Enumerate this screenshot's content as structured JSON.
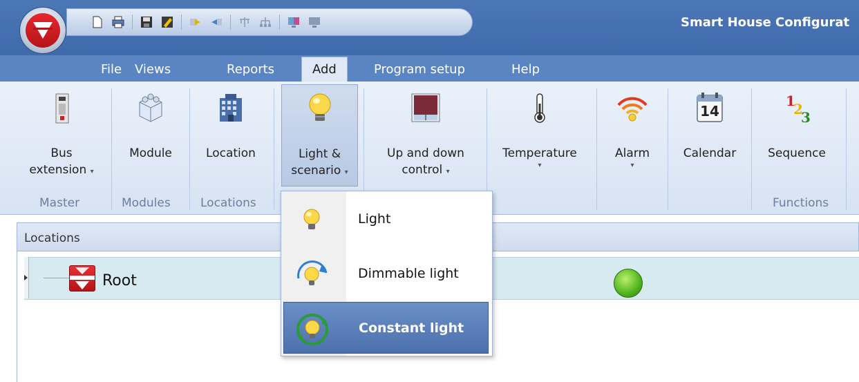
{
  "window": {
    "title": "Smart House Configurat"
  },
  "quick_access_toolbar": {
    "icons": [
      "new-document-icon",
      "print-icon",
      "save-icon",
      "edit-icon",
      "export-icon",
      "import-icon",
      "network-icon",
      "topology-icon",
      "monitor-color-icon",
      "monitor-icon"
    ]
  },
  "menubar": {
    "items": [
      {
        "label": "File"
      },
      {
        "label": "Views"
      },
      {
        "label": "Reports"
      },
      {
        "label": "Add",
        "active": true
      },
      {
        "label": "Program setup"
      },
      {
        "label": "Help"
      }
    ]
  },
  "ribbon": {
    "buttons": {
      "bus_extension": {
        "line1": "Bus",
        "line2": "extension"
      },
      "module": {
        "line1": "Module"
      },
      "location": {
        "line1": "Location"
      },
      "light_scenario": {
        "line1": "Light &",
        "line2": "scenario"
      },
      "up_down": {
        "line1": "Up and down",
        "line2": "control"
      },
      "temperature": {
        "line1": "Temperature"
      },
      "alarm": {
        "line1": "Alarm"
      },
      "calendar": {
        "line1": "Calendar",
        "day": "14"
      },
      "sequence": {
        "line1": "Sequence",
        "digits": [
          "1",
          "2",
          "3"
        ]
      }
    },
    "groups": {
      "master": "Master",
      "modules": "Modules",
      "locations": "Locations",
      "functions": "Functions"
    }
  },
  "panel": {
    "title": "Locations"
  },
  "tree": {
    "root_label": "Root",
    "status_color": "#4fb41d"
  },
  "dropdown": {
    "items": [
      {
        "label": "Light",
        "icon": "bulb-icon"
      },
      {
        "label": "Dimmable light",
        "icon": "dimmable-bulb-icon"
      },
      {
        "label": "Constant light",
        "icon": "constant-light-icon",
        "highlighted": true
      }
    ]
  },
  "colors": {
    "titlebar": "#3e69aa",
    "menubar": "#5b84c2",
    "ribbon": "#dfe9f5",
    "highlight": "#4c71ad",
    "brand_red": "#d41e25"
  }
}
